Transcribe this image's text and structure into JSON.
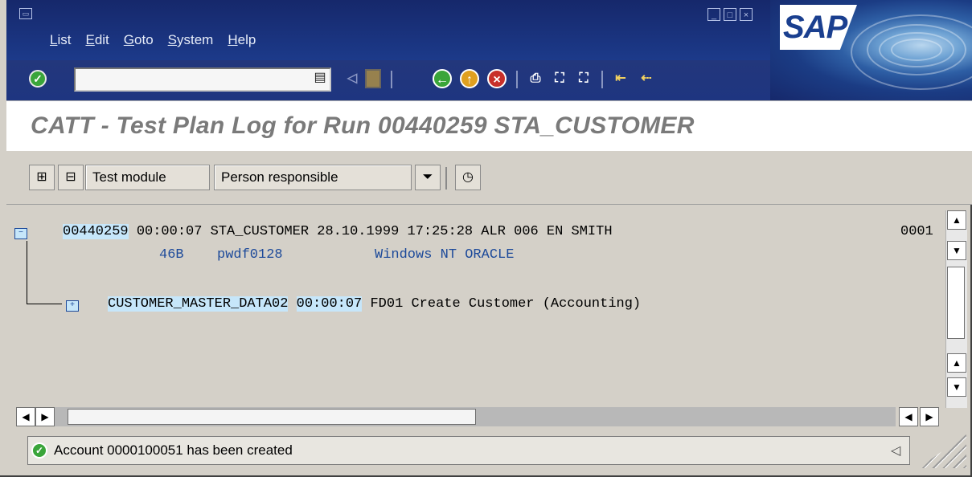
{
  "menubar": {
    "items": [
      {
        "label": "List"
      },
      {
        "label": "Edit"
      },
      {
        "label": "Goto"
      },
      {
        "label": "System"
      },
      {
        "label": "Help"
      }
    ],
    "logo": "SAP"
  },
  "toolbar": {
    "command_field": {
      "value": ""
    },
    "icons": [
      "enter-icon",
      "save-icon",
      "back-icon",
      "exit-icon",
      "cancel-icon",
      "print-icon",
      "find-icon",
      "find-next-icon",
      "first-page-icon",
      "previous-page-icon"
    ]
  },
  "title": "CATT - Test Plan Log for Run 00440259 STA_CUSTOMER",
  "app_toolbar": {
    "test_module": "Test module",
    "person_responsible": "Person responsible"
  },
  "log": {
    "header": {
      "run": "00440259",
      "time": "00:00:07",
      "rest": " STA_CUSTOMER 28.10.1999 17:25:28 ALR 006 EN SMITH",
      "page": "0001",
      "release": "46B",
      "host": "pwdf0128",
      "platform": "Windows NT ORACLE"
    },
    "child": {
      "module": "CUSTOMER_MASTER_DATA02",
      "time": "00:00:07",
      "rest": " FD01 Create Customer (Accounting)"
    }
  },
  "status": {
    "message": "Account 0000100051 has been created"
  },
  "colors": {
    "menubar": "#16286b",
    "highlight": "#c6e6fa",
    "text_blue": "#1d4a9a",
    "title_gray": "#7a7a7a",
    "ok_green": "#3aa53a"
  }
}
